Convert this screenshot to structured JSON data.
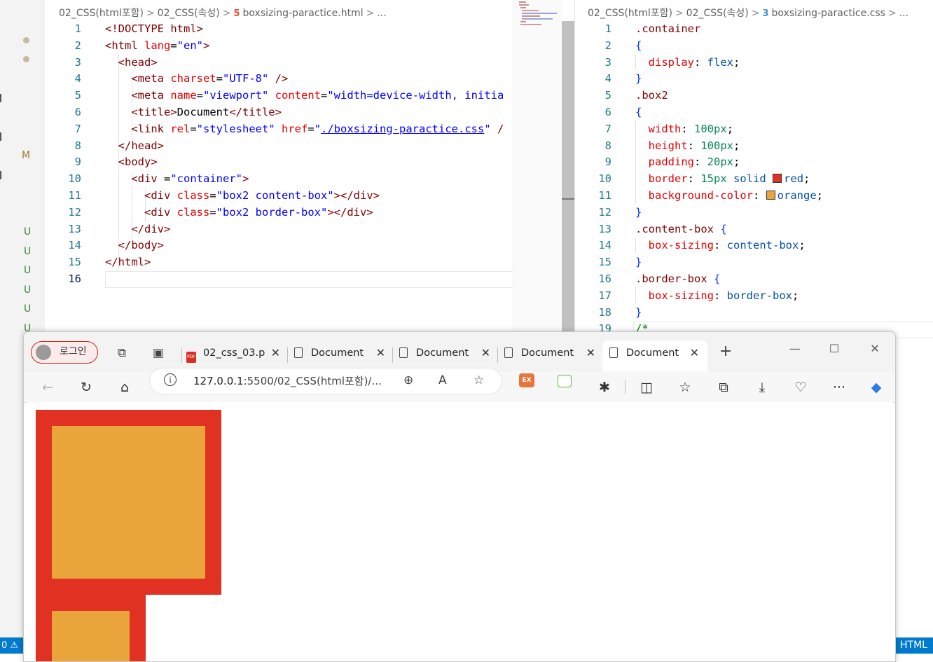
{
  "html_editor": {
    "breadcrumb": [
      "02_CSS(html포함)",
      "02_CSS(속성)",
      "boxsizing-paractice.html",
      "..."
    ],
    "lines": [
      {
        "n": "1",
        "t": [
          [
            "t-tag",
            "<!DOCTYPE html>"
          ]
        ]
      },
      {
        "n": "2",
        "t": [
          [
            "t-tag",
            "<html "
          ],
          [
            "t-attr",
            "lang"
          ],
          [
            "t-txt",
            "="
          ],
          [
            "t-str",
            "\"en\""
          ],
          [
            "t-tag",
            ">"
          ]
        ]
      },
      {
        "n": "3",
        "t": [
          [
            "t-txt",
            "  "
          ],
          [
            "t-tag",
            "<head>"
          ]
        ]
      },
      {
        "n": "4",
        "t": [
          [
            "t-txt",
            "    "
          ],
          [
            "t-tag",
            "<meta "
          ],
          [
            "t-attr",
            "charset"
          ],
          [
            "t-txt",
            "="
          ],
          [
            "t-str",
            "\"UTF-8\""
          ],
          [
            "t-tag",
            " />"
          ]
        ]
      },
      {
        "n": "5",
        "t": [
          [
            "t-txt",
            "    "
          ],
          [
            "t-tag",
            "<meta "
          ],
          [
            "t-attr",
            "name"
          ],
          [
            "t-txt",
            "="
          ],
          [
            "t-str",
            "\"viewport\""
          ],
          [
            "t-txt",
            " "
          ],
          [
            "t-attr",
            "content"
          ],
          [
            "t-txt",
            "="
          ],
          [
            "t-str",
            "\"width=device-width, initia"
          ]
        ]
      },
      {
        "n": "6",
        "t": [
          [
            "t-txt",
            "    "
          ],
          [
            "t-tag",
            "<title>"
          ],
          [
            "t-txt",
            "Document"
          ],
          [
            "t-tag",
            "</title>"
          ]
        ]
      },
      {
        "n": "7",
        "t": [
          [
            "t-txt",
            "    "
          ],
          [
            "t-tag",
            "<link "
          ],
          [
            "t-attr",
            "rel"
          ],
          [
            "t-txt",
            "="
          ],
          [
            "t-str",
            "\"stylesheet\""
          ],
          [
            "t-txt",
            " "
          ],
          [
            "t-attr",
            "href"
          ],
          [
            "t-txt",
            "="
          ],
          [
            "t-str",
            "\""
          ],
          [
            "t-link",
            "./boxsizing-paractice.css"
          ],
          [
            "t-str",
            "\""
          ],
          [
            "t-tag",
            " /"
          ]
        ]
      },
      {
        "n": "8",
        "t": [
          [
            "t-txt",
            "  "
          ],
          [
            "t-tag",
            "</head>"
          ]
        ]
      },
      {
        "n": "9",
        "t": [
          [
            "t-txt",
            "  "
          ],
          [
            "t-tag",
            "<body>"
          ]
        ]
      },
      {
        "n": "10",
        "t": [
          [
            "t-txt",
            "    "
          ],
          [
            "t-tag",
            "<div "
          ],
          [
            "t-txt",
            "="
          ],
          [
            "t-str",
            "\"container\""
          ],
          [
            "t-tag",
            ">"
          ]
        ]
      },
      {
        "n": "11",
        "t": [
          [
            "t-txt",
            "      "
          ],
          [
            "t-tag",
            "<div "
          ],
          [
            "t-attr",
            "class"
          ],
          [
            "t-txt",
            "="
          ],
          [
            "t-str",
            "\"box2 content-box\""
          ],
          [
            "t-tag",
            "></div>"
          ]
        ]
      },
      {
        "n": "12",
        "t": [
          [
            "t-txt",
            "      "
          ],
          [
            "t-tag",
            "<div "
          ],
          [
            "t-attr",
            "class"
          ],
          [
            "t-txt",
            "="
          ],
          [
            "t-str",
            "\"box2 border-box\""
          ],
          [
            "t-tag",
            "></div>"
          ]
        ]
      },
      {
        "n": "13",
        "t": [
          [
            "t-txt",
            "    "
          ],
          [
            "t-tag",
            "</div>"
          ]
        ]
      },
      {
        "n": "14",
        "t": [
          [
            "t-txt",
            "  "
          ],
          [
            "t-tag",
            "</body>"
          ]
        ]
      },
      {
        "n": "15",
        "t": [
          [
            "t-tag",
            "</html>"
          ]
        ]
      },
      {
        "n": "16",
        "t": []
      }
    ]
  },
  "css_editor": {
    "breadcrumb": [
      "02_CSS(html포함)",
      "02_CSS(속성)",
      "boxsizing-paractice.css",
      "..."
    ],
    "lines": [
      {
        "n": "1",
        "t": [
          [
            "c-sel",
            ".container"
          ]
        ]
      },
      {
        "n": "2",
        "t": [
          [
            "c-brace",
            "{"
          ]
        ]
      },
      {
        "n": "3",
        "t": [
          [
            "t-txt",
            "  "
          ],
          [
            "c-prop",
            "display"
          ],
          [
            "t-txt",
            ": "
          ],
          [
            "c-val",
            "flex"
          ],
          [
            "t-txt",
            ";"
          ]
        ]
      },
      {
        "n": "4",
        "t": [
          [
            "c-brace",
            "}"
          ]
        ]
      },
      {
        "n": "5",
        "t": [
          [
            "c-sel",
            ".box2"
          ]
        ]
      },
      {
        "n": "6",
        "t": [
          [
            "c-brace",
            "{"
          ]
        ]
      },
      {
        "n": "7",
        "t": [
          [
            "t-txt",
            "  "
          ],
          [
            "c-prop",
            "width"
          ],
          [
            "t-txt",
            ": "
          ],
          [
            "c-num",
            "100px"
          ],
          [
            "t-txt",
            ";"
          ]
        ]
      },
      {
        "n": "8",
        "t": [
          [
            "t-txt",
            "  "
          ],
          [
            "c-prop",
            "height"
          ],
          [
            "t-txt",
            ": "
          ],
          [
            "c-num",
            "100px"
          ],
          [
            "t-txt",
            ";"
          ]
        ]
      },
      {
        "n": "9",
        "t": [
          [
            "t-txt",
            "  "
          ],
          [
            "c-prop",
            "padding"
          ],
          [
            "t-txt",
            ": "
          ],
          [
            "c-num",
            "20px"
          ],
          [
            "t-txt",
            ";"
          ]
        ]
      },
      {
        "n": "10",
        "t": [
          [
            "t-txt",
            "  "
          ],
          [
            "c-prop",
            "border"
          ],
          [
            "t-txt",
            ": "
          ],
          [
            "c-num",
            "15px"
          ],
          [
            "t-txt",
            " "
          ],
          [
            "c-val",
            "solid"
          ],
          [
            "t-txt",
            " "
          ],
          [
            "swatch-red",
            ""
          ],
          [
            "c-val",
            "red"
          ],
          [
            "t-txt",
            ";"
          ]
        ]
      },
      {
        "n": "11",
        "t": [
          [
            "t-txt",
            "  "
          ],
          [
            "c-prop",
            "background-color"
          ],
          [
            "t-txt",
            ": "
          ],
          [
            "swatch-orange",
            ""
          ],
          [
            "c-val",
            "orange"
          ],
          [
            "t-txt",
            ";"
          ]
        ]
      },
      {
        "n": "12",
        "t": [
          [
            "c-brace",
            "}"
          ]
        ]
      },
      {
        "n": "13",
        "t": [
          [
            "c-sel",
            ".content-box "
          ],
          [
            "c-brace",
            "{"
          ]
        ]
      },
      {
        "n": "14",
        "t": [
          [
            "t-txt",
            "  "
          ],
          [
            "c-prop",
            "box-sizing"
          ],
          [
            "t-txt",
            ": "
          ],
          [
            "c-val",
            "content-box"
          ],
          [
            "t-txt",
            ";"
          ]
        ]
      },
      {
        "n": "15",
        "t": [
          [
            "c-brace",
            "}"
          ]
        ]
      },
      {
        "n": "16",
        "t": [
          [
            "c-sel",
            ".border-box "
          ],
          [
            "c-brace",
            "{"
          ]
        ]
      },
      {
        "n": "17",
        "t": [
          [
            "t-txt",
            "  "
          ],
          [
            "c-prop",
            "box-sizing"
          ],
          [
            "t-txt",
            ": "
          ],
          [
            "c-val",
            "border-box"
          ],
          [
            "t-txt",
            ";"
          ]
        ]
      },
      {
        "n": "18",
        "t": [
          [
            "c-brace",
            "}"
          ]
        ]
      },
      {
        "n": "19",
        "t": [
          [
            "c-cmt",
            "/*"
          ]
        ]
      }
    ]
  },
  "sidebar": {
    "git_status": [
      "M",
      "U",
      "U",
      "U",
      "U",
      "U",
      "U"
    ]
  },
  "status_bar": {
    "left": "0 ⚠",
    "language": "HTML"
  },
  "browser": {
    "profile_label": "로그인",
    "tabs": [
      {
        "label": "02_css_03.p",
        "icon": "pdf-icon",
        "active": false
      },
      {
        "label": "Document",
        "icon": "page-icon",
        "active": false
      },
      {
        "label": "Document",
        "icon": "page-icon",
        "active": false
      },
      {
        "label": "Document",
        "icon": "page-icon",
        "active": false
      },
      {
        "label": "Document",
        "icon": "page-icon",
        "active": true
      }
    ],
    "new_tab": "+",
    "url_host": "127.0.0.1",
    "url_rest": ":5500/02_CSS(html포함)/...",
    "extensions": [
      "EX"
    ]
  },
  "colors": {
    "box_border": "#e03122",
    "box_fill": "#e9a53c",
    "accent": "#007acc"
  }
}
